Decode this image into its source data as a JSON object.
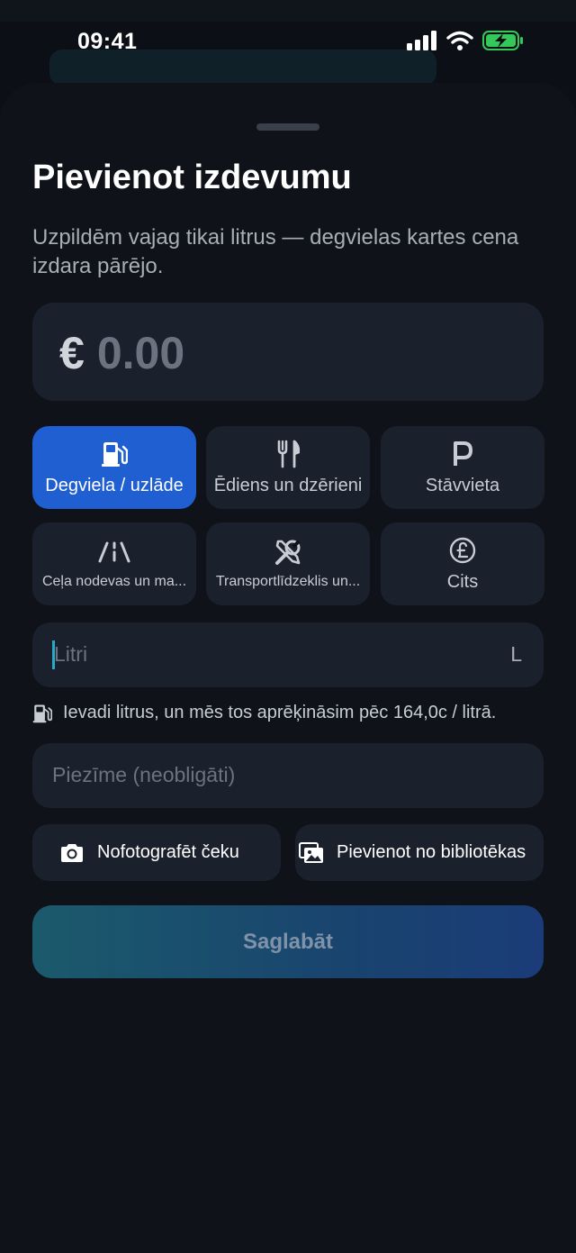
{
  "status_bar": {
    "time": "09:41"
  },
  "sheet": {
    "title": "Pievienot izdevumu",
    "subtitle": "Uzpildēm vajag tikai litrus — degvielas kartes cena izdara pārējo.",
    "amount": {
      "currency": "€",
      "value": "0.00"
    },
    "categories": [
      {
        "label": "Degviela / uzlāde",
        "icon": "fuel-pump-icon",
        "selected": true
      },
      {
        "label": "Ēdiens un dzērieni",
        "icon": "fork-knife-icon",
        "selected": false
      },
      {
        "label": "Stāvvieta",
        "icon": "parking-icon",
        "selected": false
      },
      {
        "label": "Ceļa nodevas un ma...",
        "icon": "road-icon",
        "selected": false
      },
      {
        "label": "Transportlīdzeklis un...",
        "icon": "wrench-screwdriver-icon",
        "selected": false
      },
      {
        "label": "Cits",
        "icon": "pound-coin-icon",
        "selected": false
      }
    ],
    "liters_input": {
      "placeholder": "Litri",
      "unit": "L"
    },
    "hint": "Ievadi litrus, un mēs tos aprēķināsim pēc 164,0c / litrā.",
    "note_input": {
      "placeholder": "Piezīme (neobligāti)"
    },
    "photo_button": "Nofotografēt čeku",
    "library_button": "Pievienot no bibliotēkas",
    "save_button": "Saglabāt"
  },
  "colors": {
    "accent": "#1f5fd1",
    "background": "#0f1218",
    "field": "#1b212c",
    "battery": "#34c759"
  }
}
